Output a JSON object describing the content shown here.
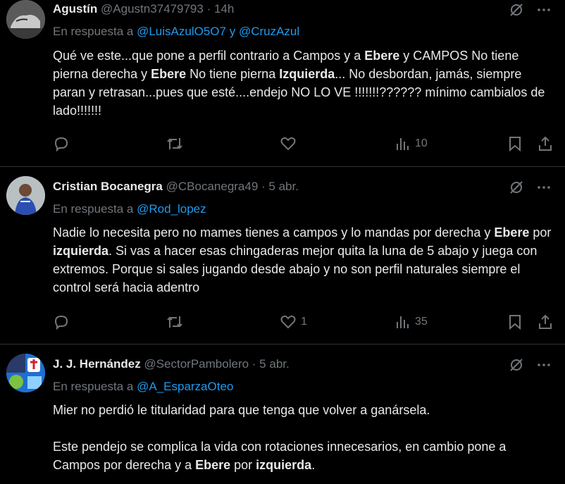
{
  "tweets": [
    {
      "name": "Agustín",
      "handle": "@Agustn37479793",
      "time": "· 14h",
      "reply_prefix": "En respuesta a",
      "mentions": [
        "@LuisAzulO5O7",
        "@CruzAzul"
      ],
      "reply_joiner": "y",
      "body_parts": [
        {
          "t": "Qué ve este...que pone a perfil contrario a Campos y a ",
          "b": false
        },
        {
          "t": "Ebere",
          "b": true
        },
        {
          "t": " y CAMPOS No tiene pierna derecha y ",
          "b": false
        },
        {
          "t": "Ebere",
          "b": true
        },
        {
          "t": " No tiene pierna ",
          "b": false
        },
        {
          "t": "Izquierda",
          "b": true
        },
        {
          "t": "... No desbordan, jamás, siempre paran y retrasan...pues que esté....endejo NO LO  VE !!!!!!!?????? mínimo cambialos de lado!!!!!!!",
          "b": false
        }
      ],
      "likes": "",
      "views": "10"
    },
    {
      "name": "Cristian Bocanegra",
      "handle": "@CBocanegra49",
      "time": "· 5 abr.",
      "reply_prefix": "En respuesta a",
      "mentions": [
        "@Rod_lopez"
      ],
      "reply_joiner": "",
      "body_parts": [
        {
          "t": "Nadie lo necesita pero no mames tienes a campos y lo mandas por derecha y ",
          "b": false
        },
        {
          "t": "Ebere",
          "b": true
        },
        {
          "t": " por ",
          "b": false
        },
        {
          "t": "izquierda",
          "b": true
        },
        {
          "t": ". Si vas a hacer esas chingaderas mejor quita la luna de 5 abajo y juega con extremos. Porque si sales jugando desde abajo y no son perfil naturales siempre el control será hacia adentro",
          "b": false
        }
      ],
      "likes": "1",
      "views": "35"
    },
    {
      "name": "J. J. Hernández",
      "handle": "@SectorPambolero",
      "time": "· 5 abr.",
      "reply_prefix": "En respuesta a",
      "mentions": [
        "@A_EsparzaOteo"
      ],
      "reply_joiner": "",
      "body_parts": [
        {
          "t": "Mier no perdió le titularidad para que tenga que volver a ganársela.",
          "b": false
        },
        {
          "t": "\n\n",
          "b": false
        },
        {
          "t": "Este pendejo se complica la vida con rotaciones innecesarios, en cambio pone a Campos por derecha y a ",
          "b": false
        },
        {
          "t": "Ebere",
          "b": true
        },
        {
          "t": " por ",
          "b": false
        },
        {
          "t": "izquierda",
          "b": true
        },
        {
          "t": ".",
          "b": false
        }
      ],
      "likes": "",
      "views": ""
    }
  ],
  "colors": {
    "accent": "#1d9bf0",
    "muted": "#71767b",
    "text": "#e7e9ea",
    "divider": "#2f3336",
    "bg": "#000000"
  },
  "icons": [
    "grok-slash-icon",
    "more-icon",
    "reply-icon",
    "retweet-icon",
    "like-icon",
    "views-icon",
    "bookmark-icon",
    "share-icon"
  ]
}
